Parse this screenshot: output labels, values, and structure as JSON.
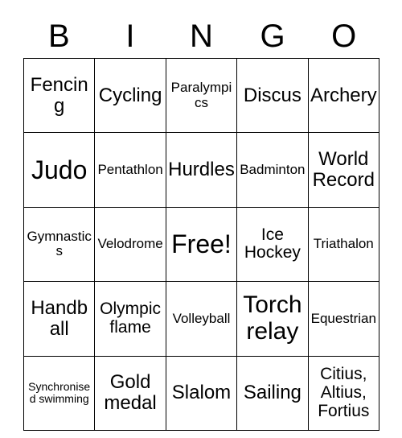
{
  "card": {
    "title": "BINGO",
    "header_letters": [
      "B",
      "I",
      "N",
      "G",
      "O"
    ],
    "free_space_label": "Free!",
    "border_color": "#000000",
    "background_color": "#ffffff",
    "text_color": "#000000",
    "rows": 5,
    "columns": 5,
    "cells": [
      [
        {
          "label": "Fencing",
          "size": "md"
        },
        {
          "label": "Cycling",
          "size": "md"
        },
        {
          "label": "Paralympics",
          "size": "xs"
        },
        {
          "label": "Discus",
          "size": "md"
        },
        {
          "label": "Archery",
          "size": "md"
        }
      ],
      [
        {
          "label": "Judo",
          "size": "xl"
        },
        {
          "label": "Pentathlon",
          "size": "xs"
        },
        {
          "label": "Hurdles",
          "size": "md"
        },
        {
          "label": "Badminton",
          "size": "xs"
        },
        {
          "label": "World Record",
          "size": "md"
        }
      ],
      [
        {
          "label": "Gymnastics",
          "size": "xs"
        },
        {
          "label": "Velodrome",
          "size": "xs"
        },
        {
          "label": "Free!",
          "size": "xl"
        },
        {
          "label": "Ice Hockey",
          "size": "sm"
        },
        {
          "label": "Triathalon",
          "size": "xs"
        }
      ],
      [
        {
          "label": "Handball",
          "size": "md"
        },
        {
          "label": "Olympic flame",
          "size": "sm"
        },
        {
          "label": "Volleyball",
          "size": "xs"
        },
        {
          "label": "Torch relay",
          "size": "lg"
        },
        {
          "label": "Equestrian",
          "size": "xs"
        }
      ],
      [
        {
          "label": "Synchronised swimming",
          "size": "xxs"
        },
        {
          "label": "Gold medal",
          "size": "md"
        },
        {
          "label": "Slalom",
          "size": "md"
        },
        {
          "label": "Sailing",
          "size": "md"
        },
        {
          "label": "Citius, Altius, Fortius",
          "size": "sm"
        }
      ]
    ]
  }
}
